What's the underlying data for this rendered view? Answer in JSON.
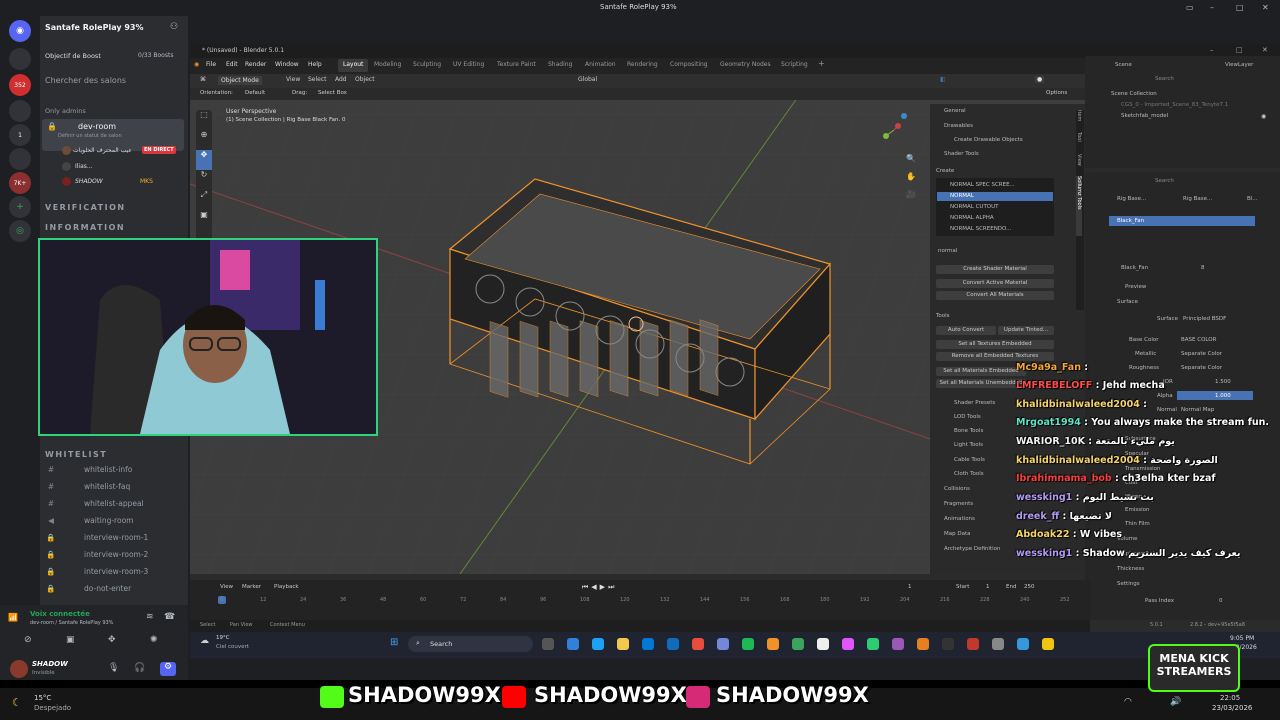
{
  "window": {
    "title": "Santafe RolePlay 93%"
  },
  "discord": {
    "server_name": "Santafe RolePlay 93%",
    "boost_label": "Objectif de Boost",
    "boost_count": "0/33 Boosts",
    "search_label": "Chercher des salons",
    "only_admins": "Only admins",
    "dev_room": "dev-room",
    "dev_room_status": "Définir un statut de salon",
    "live_user": "عيب المحترف الحلويات",
    "live_badge": "EN DIRECT",
    "user2": "Ilias...",
    "user3": "SHADOW",
    "user3_tag": "MKS",
    "cat_verification": "VERIFICATION",
    "cat_information": "INFORMATION",
    "cat_whitelist": "WHITELIST",
    "whitelist_channels": [
      "whitelist-info",
      "whitelist-faq",
      "whitelist-appeal",
      "waiting-room",
      "interview-room-1",
      "interview-room-2",
      "interview-room-3",
      "do-not-enter"
    ],
    "voice_status": "Voix connectée",
    "voice_room": "dev-room / Santafe RolePlay 93%",
    "username": "SHADOW",
    "user_status": "Invisible",
    "guild_badges": [
      "352",
      "1",
      "7K+"
    ]
  },
  "blender": {
    "title": "* (Unsaved) - Blender 5.0.1",
    "menus": [
      "File",
      "Edit",
      "Render",
      "Window",
      "Help"
    ],
    "workspaces": [
      "Layout",
      "Modeling",
      "Sculpting",
      "UV Editing",
      "Texture Paint",
      "Shading",
      "Animation",
      "Rendering",
      "Compositing",
      "Geometry Nodes",
      "Scripting"
    ],
    "mode": "Object Mode",
    "view_menus": [
      "View",
      "Select",
      "Add",
      "Object"
    ],
    "orientation": "Global",
    "viewport_label": "User Perspective",
    "viewport_sub": "(1) Scene Collection | Rig Base Black Fan. 0",
    "orient_label": "Orientation:",
    "orient_value": "Default",
    "drag_label": "Drag:",
    "drag_value": "Select Box",
    "options": "Options",
    "npanel": {
      "general": "General",
      "drawables": "Drawables",
      "create_drawable": "Create Drawable Objects",
      "shader_tools": "Shader Tools",
      "create": "Create",
      "shader_list": [
        "NORMAL SPEC SCREE...",
        "NORMAL",
        "NORMAL CUTOUT",
        "NORMAL ALPHA",
        "NORMAL SCREENDO..."
      ],
      "search_value": "normal",
      "create_shader_material": "Create Shader Material",
      "convert_active": "Convert Active Material",
      "convert_all": "Convert All Materials",
      "tools": "Tools",
      "auto_convert": "Auto Convert",
      "update_tinted": "Update Tinted...",
      "set_all_embedded": "Set all Textures Embedded",
      "remove_embedded": "Remove all Embedded Textures",
      "set_all_materials": "Set all Materials Embedded",
      "set_all_materials2": "Set all Materials Unembedded",
      "sections": [
        "Shader Presets",
        "LOD Tools",
        "Bone Tools",
        "Light Tools",
        "Cable Tools",
        "Cloth Tools",
        "Collisions",
        "Fragments",
        "Animations",
        "Map Data",
        "Archetype Definition"
      ],
      "tabs": [
        "Item",
        "Tool",
        "View",
        "Sollumz Tools"
      ]
    },
    "outliner": {
      "scene": "Scene",
      "viewlayer": "ViewLayer",
      "search": "Search",
      "root": "Scene Collection",
      "items": [
        "CGS_0 - Imported_Scene_83_Tenyte7.1",
        "Sketchfab_model"
      ]
    },
    "properties": {
      "search": "Search",
      "breadcrumb": [
        "Rig Base...",
        "Rig Base...",
        "Bl..."
      ],
      "material_slot": "Black_Fan",
      "material_name": "Black_Fan",
      "user_count": "8",
      "preview": "Preview",
      "surface": "Surface",
      "surface_label": "Surface",
      "surface_value": "Principled BSDF",
      "rows": [
        {
          "label": "Base Color",
          "value": "BASE COLOR"
        },
        {
          "label": "Metallic",
          "value": "Separate Color"
        },
        {
          "label": "Roughness",
          "value": "Separate Color"
        },
        {
          "label": "IOR",
          "value": "1.500"
        },
        {
          "label": "Alpha",
          "value": "1.000"
        },
        {
          "label": "Normal",
          "value": "Normal Map"
        }
      ],
      "subsections": [
        "Subsurface",
        "Specular",
        "Transmission",
        "Coat",
        "Sheen",
        "Emission",
        "Thin Film",
        "Volume",
        "Displacement",
        "Thickness",
        "Settings"
      ],
      "pass_index_label": "Pass Index",
      "pass_index_value": "0"
    },
    "timeline": {
      "menus": [
        "View",
        "Marker",
        "Playback"
      ],
      "current_frame": "1",
      "start_label": "Start",
      "start": "1",
      "end_label": "End",
      "end": "250",
      "ticks": [
        "0",
        "12",
        "24",
        "36",
        "48",
        "60",
        "72",
        "84",
        "96",
        "108",
        "120",
        "132",
        "144",
        "156",
        "168",
        "180",
        "192",
        "204",
        "216",
        "228",
        "240",
        "252"
      ]
    },
    "statusbar": [
      "Select",
      "Pan View",
      "Context Menu"
    ],
    "version": "5.0.1",
    "version2": "2.8.2 - dev+95e5f5a8"
  },
  "inner_taskbar": {
    "weather_temp": "19°C",
    "weather_desc": "Ciel couvert",
    "search": "Search",
    "time": "9:05 PM",
    "date": "3/23/2026"
  },
  "chat": [
    {
      "user": "Mc9a9a_Fan",
      "color": "#f4a83a",
      "msg": ""
    },
    {
      "user": "LMFREBELOFF",
      "color": "#ff4b4b",
      "msg": "Jehd mecha"
    },
    {
      "user": "khalidbinalwaleed2004",
      "color": "#f6d36b",
      "msg": ""
    },
    {
      "user": "Mrgoat1994",
      "color": "#5fe3c7",
      "msg": "You always make the stream fun."
    },
    {
      "user": "WARIOR_10K",
      "color": "#f2f2f2",
      "msg": "يوم مليء بالمتعة"
    },
    {
      "user": "khalidbinalwaleed2004",
      "color": "#f6d36b",
      "msg": "الصورة واضحة"
    },
    {
      "user": "Ibrahimnama_bob",
      "color": "#ff3c3c",
      "msg": "ch3elha kter bzaf"
    },
    {
      "user": "wessking1",
      "color": "#b39bf5",
      "msg": "بث نشيط اليوم"
    },
    {
      "user": "dreek_ff",
      "color": "#b39bf5",
      "msg": "لا تضيعها"
    },
    {
      "user": "Abdoak22",
      "color": "#f6d36b",
      "msg": "W vibes"
    },
    {
      "user": "wessking1",
      "color": "#b39bf5",
      "msg": "Shadow يعرف كيف يدير الستريم"
    }
  ],
  "socials": {
    "kick": "SHADOW99X",
    "youtube": "SHADOW99X",
    "instagram": "SHADOW99X",
    "badge_line1": "MENA KICK",
    "badge_line2": "STREAMERS"
  },
  "outer_taskbar": {
    "weather_temp": "15°C",
    "weather_desc": "Despejado",
    "time": "22:05",
    "date": "23/03/2026"
  },
  "colors": {
    "discord_bg": "#2b2d31",
    "blender_accent": "#4772b3",
    "selection_orange": "#f0922a",
    "webcam_border": "#2fd37c",
    "live_red": "#da373c"
  }
}
